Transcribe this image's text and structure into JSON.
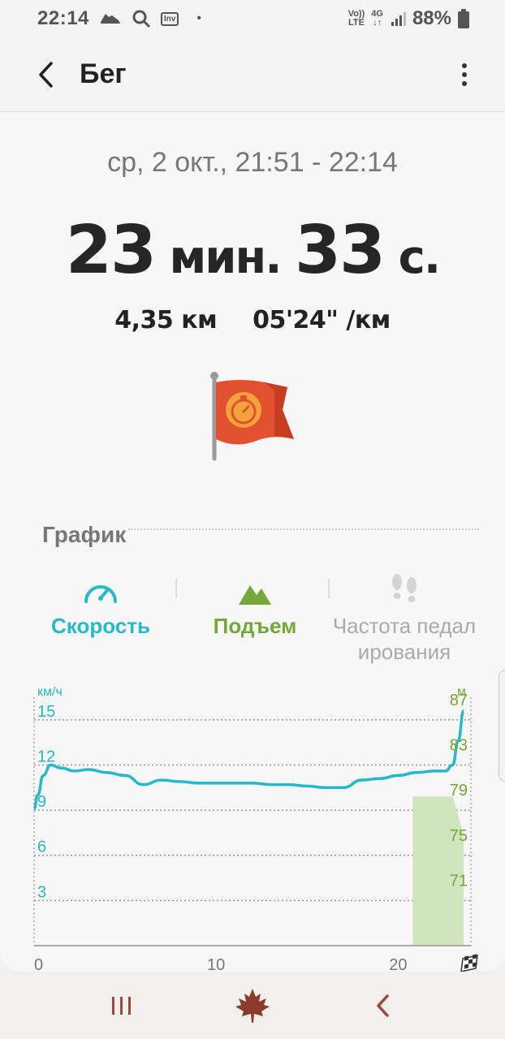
{
  "status_bar": {
    "time": "22:14",
    "icons": [
      "shoe-icon",
      "search-icon",
      "inv-icon",
      "dot-icon"
    ],
    "inv_label": "Inv",
    "volte_top": "Vo))",
    "volte_bottom": "LTE",
    "network_top": "4G",
    "network_bottom": "↓↑",
    "battery_percent": "88%"
  },
  "app_bar": {
    "title": "Бег",
    "back_icon": "chevron-left-icon",
    "menu_icon": "more-vert-icon"
  },
  "workout": {
    "date_range": "ср, 2 окт., 21:51 - 22:14",
    "duration_minutes": "23",
    "duration_minutes_unit": " мин. ",
    "duration_seconds": "33",
    "duration_seconds_unit": " с.",
    "distance": "4,35 км",
    "pace": "05'24\" /км",
    "badge_icon": "stopwatch-flag-icon"
  },
  "chart_section": {
    "title": "График",
    "tabs": [
      {
        "label": "Скорость",
        "icon": "speedometer-icon",
        "color": "#26b9c9"
      },
      {
        "label": "Подъем",
        "icon": "mountain-icon",
        "color": "#74a83a"
      },
      {
        "label": "Частота педал ирования",
        "icon": "footprints-icon",
        "color": "#aaaaaa"
      }
    ]
  },
  "chart_data": {
    "type": "line",
    "xlabel": "",
    "x_ticks": [
      "0",
      "10",
      "20"
    ],
    "xlim": [
      0,
      24
    ],
    "finish_icon": "checkered-flag-icon",
    "left_axis": {
      "unit": "км/ч",
      "ticks": [
        "15",
        "12",
        "9",
        "6",
        "3"
      ],
      "ylim": [
        0,
        16.5
      ],
      "color": "#26b9c9"
    },
    "right_axis": {
      "unit": "м",
      "ticks": [
        "87",
        "83",
        "79",
        "75",
        "71"
      ],
      "ylim": [
        66,
        88
      ],
      "color": "#74a83a"
    },
    "series": [
      {
        "axis": "left",
        "color": "#26b9c9",
        "x": [
          0,
          0.2,
          0.5,
          0.9,
          1.5,
          2.2,
          3.0,
          4.0,
          5.0,
          6.0,
          7.0,
          8.0,
          9.0,
          10.0,
          11.0,
          12.0,
          13.0,
          14.0,
          15.0,
          16.0,
          17.0,
          18.0,
          19.0,
          20.0,
          21.0,
          22.0,
          22.6,
          23.0,
          23.3,
          23.6
        ],
        "values": [
          9.1,
          10.0,
          11.3,
          12.0,
          11.8,
          11.6,
          11.7,
          11.5,
          11.3,
          10.7,
          11.0,
          10.9,
          10.8,
          10.8,
          10.8,
          10.8,
          10.7,
          10.7,
          10.6,
          10.5,
          10.5,
          11.0,
          11.1,
          11.3,
          11.5,
          11.6,
          11.6,
          12.0,
          13.6,
          15.6
        ]
      },
      {
        "axis": "right",
        "color": "#cfe5bd",
        "type": "area",
        "x": [
          20.8,
          23.0,
          23.6
        ],
        "values": [
          79.2,
          79.2,
          75.8
        ]
      }
    ]
  },
  "navigation_bar": {
    "recents_icon": "recents-icon",
    "home_icon": "maple-leaf-icon",
    "back_icon": "back-chevron-icon"
  }
}
